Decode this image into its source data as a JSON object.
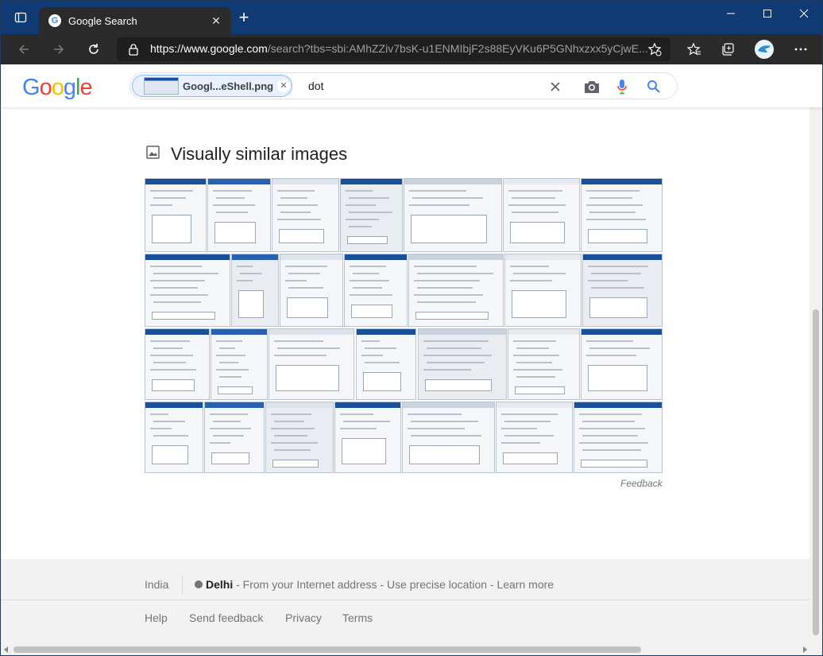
{
  "browser": {
    "tab_title": "Google Search",
    "url_host": "https://www.google.com",
    "url_path": "/search?tbs=sbi:AMhZZiv7bsK-u1ENMIbjF2s88EyVKu6P5GNhxzxx5yCjwE...",
    "icons": [
      "tab-actions-icon",
      "close-icon",
      "new-tab-icon",
      "minimize-icon",
      "maximize-icon",
      "window-close-icon",
      "back-icon",
      "forward-icon",
      "refresh-icon",
      "lock-icon",
      "favorite-add-icon",
      "favorites-icon",
      "collections-icon",
      "profile-icon",
      "more-icon"
    ]
  },
  "google": {
    "logo": [
      "G",
      "o",
      "o",
      "g",
      "l",
      "e"
    ],
    "logo_colors": [
      "#4285f4",
      "#ea4335",
      "#fbbc05",
      "#4285f4",
      "#34a853",
      "#ea4335"
    ],
    "chip_label": "Googl...eShell.png",
    "query": "dot"
  },
  "results": {
    "section_title": "Visually similar images",
    "feedback": "Feedback",
    "thumbnail_count": 28
  },
  "footer": {
    "country": "India",
    "city": "Delhi",
    "location_note": " - From your Internet address - Use precise location - Learn more",
    "links": [
      "Help",
      "Send feedback",
      "Privacy",
      "Terms"
    ]
  }
}
